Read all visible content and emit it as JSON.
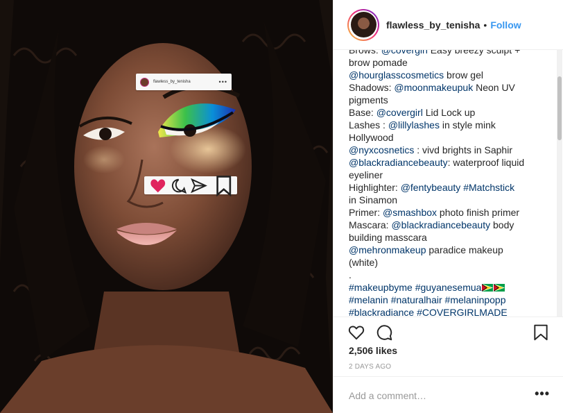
{
  "post": {
    "image_alt": "Close-up portrait of a woman with curly black hair wearing bright blue, green and yellow eye makeup, with Instagram-style frames drawn on her face",
    "image_overlay": {
      "top_frame_username": "flawless_by_tenisha",
      "top_frame_dots": "•••",
      "icons": [
        "heart-icon",
        "comment-icon",
        "send-icon",
        "bookmark-icon"
      ]
    }
  },
  "header": {
    "username": "flawless_by_tenisha",
    "separator": "•",
    "follow_label": "Follow"
  },
  "caption": {
    "lines": [
      [
        {
          "t": "Brows: "
        },
        {
          "t": "@covergirl",
          "link": true
        },
        {
          "t": " Easy breezy sculpt +"
        }
      ],
      [
        {
          "t": "brow pomade"
        }
      ],
      [
        {
          "t": "@hourglasscosmetics",
          "link": true
        },
        {
          "t": " brow gel"
        }
      ],
      [
        {
          "t": "Shadows: "
        },
        {
          "t": "@moonmakeupuk",
          "link": true
        },
        {
          "t": " Neon UV"
        }
      ],
      [
        {
          "t": "pigments"
        }
      ],
      [
        {
          "t": "Base: "
        },
        {
          "t": "@covergirl",
          "link": true
        },
        {
          "t": " Lid Lock up"
        }
      ],
      [
        {
          "t": "Lashes : "
        },
        {
          "t": "@lillylashes",
          "link": true
        },
        {
          "t": " in style mink"
        }
      ],
      [
        {
          "t": "Hollywood"
        }
      ],
      [
        {
          "t": "@nyxcosnetics",
          "link": true
        },
        {
          "t": " : vivd brights in Saphir"
        }
      ],
      [
        {
          "t": "@blackradiancebeauty",
          "link": true
        },
        {
          "t": ": waterproof liquid"
        }
      ],
      [
        {
          "t": "eyeliner"
        }
      ],
      [
        {
          "t": "Highlighter: "
        },
        {
          "t": "@fentybeauty",
          "link": true
        },
        {
          "t": " "
        },
        {
          "t": "#Matchstick",
          "link": true
        }
      ],
      [
        {
          "t": "in Sinamon"
        }
      ],
      [
        {
          "t": "Primer: "
        },
        {
          "t": "@smashbox",
          "link": true
        },
        {
          "t": " photo finish primer"
        }
      ],
      [
        {
          "t": "Mascara: "
        },
        {
          "t": "@blackradiancebeauty",
          "link": true
        },
        {
          "t": " body"
        }
      ],
      [
        {
          "t": "building masscara"
        }
      ],
      [
        {
          "t": "@mehronmakeup",
          "link": true
        },
        {
          "t": " paradice makeup"
        }
      ],
      [
        {
          "t": "(white)"
        }
      ],
      [
        {
          "t": "."
        }
      ],
      [
        {
          "t": "#makeupbyme",
          "link": true
        },
        {
          "t": " "
        },
        {
          "t": "#guyanesemua",
          "link": true
        },
        {
          "flag": true
        },
        {
          "flag": true
        }
      ],
      [
        {
          "t": "#melanin",
          "link": true
        },
        {
          "t": " "
        },
        {
          "t": "#naturalhair",
          "link": true
        },
        {
          "t": " "
        },
        {
          "t": "#melaninpopp",
          "link": true
        }
      ],
      [
        {
          "t": "#blackradiance",
          "link": true
        },
        {
          "t": " "
        },
        {
          "t": "#COVERGIRLMADE",
          "link": true
        }
      ]
    ]
  },
  "actions": {
    "like_icon": "heart-icon",
    "comment_icon": "comment-icon",
    "save_icon": "bookmark-icon",
    "likes_text": "2,506 likes",
    "timestamp": "2 DAYS AGO"
  },
  "comment": {
    "placeholder": "Add a comment…",
    "more_label": "•••"
  },
  "colors": {
    "link": "#003569",
    "follow": "#3897f0",
    "text": "#262626",
    "muted": "#999999",
    "border": "#efefef"
  }
}
